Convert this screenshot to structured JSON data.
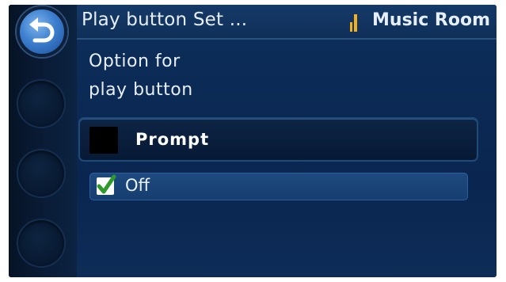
{
  "header": {
    "title": "Play button Set ...",
    "room": "Music Room"
  },
  "question": {
    "line1": "Option for",
    "line2": "play button"
  },
  "options": [
    {
      "label": "Prompt",
      "checked": false,
      "selected": true
    },
    {
      "label": "Off",
      "checked": true,
      "selected": false
    }
  ],
  "icons": {
    "back": "back-arrow-icon",
    "signal": "signal-strength-icon",
    "check": "checkmark-icon"
  },
  "colors": {
    "accent": "#3c7fcf",
    "signal": "#f2b01e",
    "check": "#2f9a2c"
  }
}
